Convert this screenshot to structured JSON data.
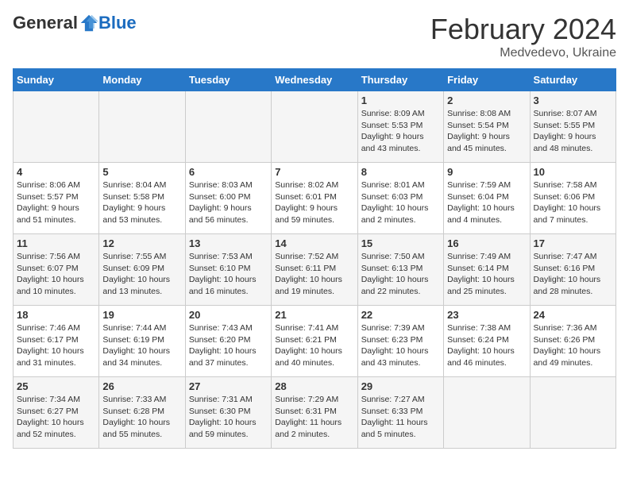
{
  "header": {
    "logo_general": "General",
    "logo_blue": "Blue",
    "month_title": "February 2024",
    "location": "Medvedevo, Ukraine"
  },
  "days_of_week": [
    "Sunday",
    "Monday",
    "Tuesday",
    "Wednesday",
    "Thursday",
    "Friday",
    "Saturday"
  ],
  "weeks": [
    [
      {
        "day": "",
        "info": ""
      },
      {
        "day": "",
        "info": ""
      },
      {
        "day": "",
        "info": ""
      },
      {
        "day": "",
        "info": ""
      },
      {
        "day": "1",
        "info": "Sunrise: 8:09 AM\nSunset: 5:53 PM\nDaylight: 9 hours\nand 43 minutes."
      },
      {
        "day": "2",
        "info": "Sunrise: 8:08 AM\nSunset: 5:54 PM\nDaylight: 9 hours\nand 45 minutes."
      },
      {
        "day": "3",
        "info": "Sunrise: 8:07 AM\nSunset: 5:55 PM\nDaylight: 9 hours\nand 48 minutes."
      }
    ],
    [
      {
        "day": "4",
        "info": "Sunrise: 8:06 AM\nSunset: 5:57 PM\nDaylight: 9 hours\nand 51 minutes."
      },
      {
        "day": "5",
        "info": "Sunrise: 8:04 AM\nSunset: 5:58 PM\nDaylight: 9 hours\nand 53 minutes."
      },
      {
        "day": "6",
        "info": "Sunrise: 8:03 AM\nSunset: 6:00 PM\nDaylight: 9 hours\nand 56 minutes."
      },
      {
        "day": "7",
        "info": "Sunrise: 8:02 AM\nSunset: 6:01 PM\nDaylight: 9 hours\nand 59 minutes."
      },
      {
        "day": "8",
        "info": "Sunrise: 8:01 AM\nSunset: 6:03 PM\nDaylight: 10 hours\nand 2 minutes."
      },
      {
        "day": "9",
        "info": "Sunrise: 7:59 AM\nSunset: 6:04 PM\nDaylight: 10 hours\nand 4 minutes."
      },
      {
        "day": "10",
        "info": "Sunrise: 7:58 AM\nSunset: 6:06 PM\nDaylight: 10 hours\nand 7 minutes."
      }
    ],
    [
      {
        "day": "11",
        "info": "Sunrise: 7:56 AM\nSunset: 6:07 PM\nDaylight: 10 hours\nand 10 minutes."
      },
      {
        "day": "12",
        "info": "Sunrise: 7:55 AM\nSunset: 6:09 PM\nDaylight: 10 hours\nand 13 minutes."
      },
      {
        "day": "13",
        "info": "Sunrise: 7:53 AM\nSunset: 6:10 PM\nDaylight: 10 hours\nand 16 minutes."
      },
      {
        "day": "14",
        "info": "Sunrise: 7:52 AM\nSunset: 6:11 PM\nDaylight: 10 hours\nand 19 minutes."
      },
      {
        "day": "15",
        "info": "Sunrise: 7:50 AM\nSunset: 6:13 PM\nDaylight: 10 hours\nand 22 minutes."
      },
      {
        "day": "16",
        "info": "Sunrise: 7:49 AM\nSunset: 6:14 PM\nDaylight: 10 hours\nand 25 minutes."
      },
      {
        "day": "17",
        "info": "Sunrise: 7:47 AM\nSunset: 6:16 PM\nDaylight: 10 hours\nand 28 minutes."
      }
    ],
    [
      {
        "day": "18",
        "info": "Sunrise: 7:46 AM\nSunset: 6:17 PM\nDaylight: 10 hours\nand 31 minutes."
      },
      {
        "day": "19",
        "info": "Sunrise: 7:44 AM\nSunset: 6:19 PM\nDaylight: 10 hours\nand 34 minutes."
      },
      {
        "day": "20",
        "info": "Sunrise: 7:43 AM\nSunset: 6:20 PM\nDaylight: 10 hours\nand 37 minutes."
      },
      {
        "day": "21",
        "info": "Sunrise: 7:41 AM\nSunset: 6:21 PM\nDaylight: 10 hours\nand 40 minutes."
      },
      {
        "day": "22",
        "info": "Sunrise: 7:39 AM\nSunset: 6:23 PM\nDaylight: 10 hours\nand 43 minutes."
      },
      {
        "day": "23",
        "info": "Sunrise: 7:38 AM\nSunset: 6:24 PM\nDaylight: 10 hours\nand 46 minutes."
      },
      {
        "day": "24",
        "info": "Sunrise: 7:36 AM\nSunset: 6:26 PM\nDaylight: 10 hours\nand 49 minutes."
      }
    ],
    [
      {
        "day": "25",
        "info": "Sunrise: 7:34 AM\nSunset: 6:27 PM\nDaylight: 10 hours\nand 52 minutes."
      },
      {
        "day": "26",
        "info": "Sunrise: 7:33 AM\nSunset: 6:28 PM\nDaylight: 10 hours\nand 55 minutes."
      },
      {
        "day": "27",
        "info": "Sunrise: 7:31 AM\nSunset: 6:30 PM\nDaylight: 10 hours\nand 59 minutes."
      },
      {
        "day": "28",
        "info": "Sunrise: 7:29 AM\nSunset: 6:31 PM\nDaylight: 11 hours\nand 2 minutes."
      },
      {
        "day": "29",
        "info": "Sunrise: 7:27 AM\nSunset: 6:33 PM\nDaylight: 11 hours\nand 5 minutes."
      },
      {
        "day": "",
        "info": ""
      },
      {
        "day": "",
        "info": ""
      }
    ]
  ]
}
